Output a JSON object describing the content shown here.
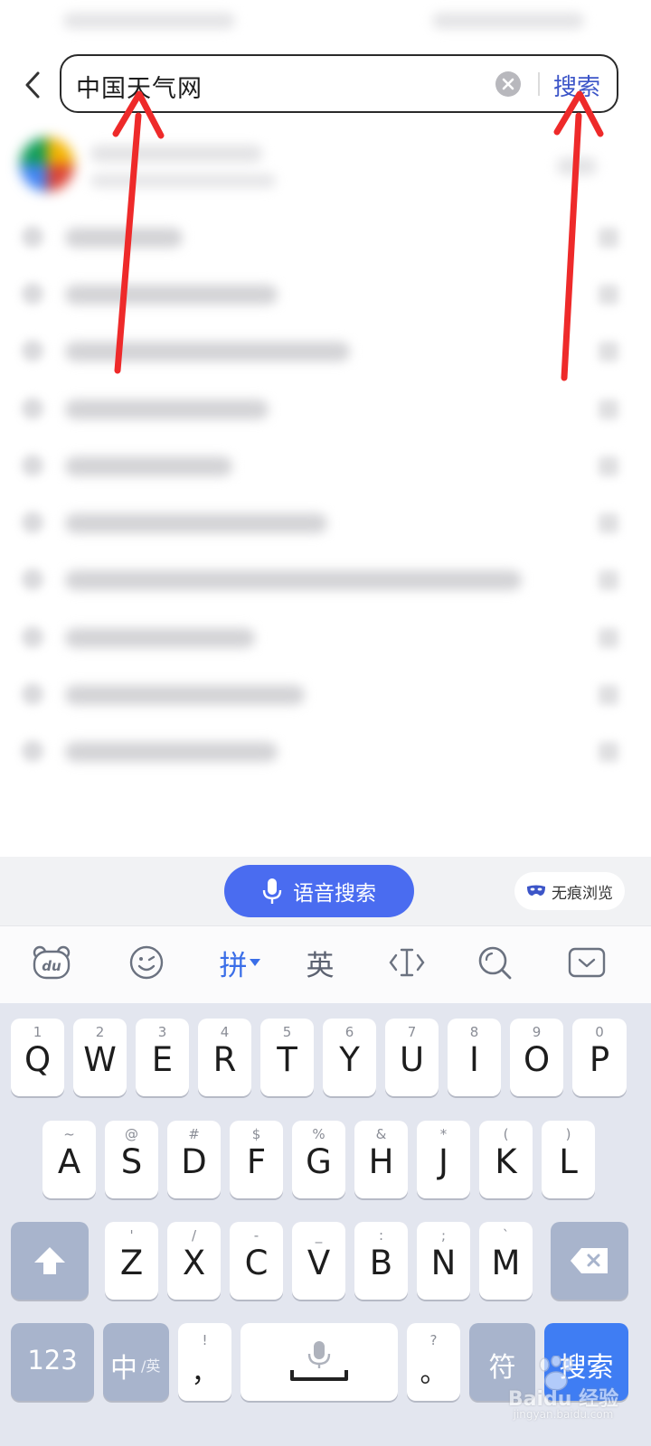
{
  "search": {
    "query": "中国天气网",
    "submit_label": "搜索"
  },
  "keyboard_bar": {
    "voice_label": "语音搜索",
    "incognito_label": "无痕浏览"
  },
  "toolbar": {
    "pinyin_label": "拼",
    "english_label": "英"
  },
  "keyboard": {
    "row1": [
      {
        "num": "1",
        "letter": "Q"
      },
      {
        "num": "2",
        "letter": "W"
      },
      {
        "num": "3",
        "letter": "E"
      },
      {
        "num": "4",
        "letter": "R"
      },
      {
        "num": "5",
        "letter": "T"
      },
      {
        "num": "6",
        "letter": "Y"
      },
      {
        "num": "7",
        "letter": "U"
      },
      {
        "num": "8",
        "letter": "I"
      },
      {
        "num": "9",
        "letter": "O"
      },
      {
        "num": "0",
        "letter": "P"
      }
    ],
    "row2": [
      {
        "num": "~",
        "letter": "A"
      },
      {
        "num": "@",
        "letter": "S"
      },
      {
        "num": "#",
        "letter": "D"
      },
      {
        "num": "$",
        "letter": "F"
      },
      {
        "num": "%",
        "letter": "G"
      },
      {
        "num": "&",
        "letter": "H"
      },
      {
        "num": "*",
        "letter": "J"
      },
      {
        "num": "(",
        "letter": "K"
      },
      {
        "num": ")",
        "letter": "L"
      }
    ],
    "row3": [
      {
        "num": "'",
        "letter": "Z"
      },
      {
        "num": "/",
        "letter": "X"
      },
      {
        "num": "-",
        "letter": "C"
      },
      {
        "num": "_",
        "letter": "V"
      },
      {
        "num": ":",
        "letter": "B"
      },
      {
        "num": ";",
        "letter": "N"
      },
      {
        "num": "`",
        "letter": "M"
      }
    ],
    "num_key": "123",
    "lang_key_main": "中",
    "lang_key_sub": "/英",
    "comma_top": "!",
    "comma_main": "，",
    "period_top": "?",
    "period_main": "。",
    "symbol_key": "符",
    "search_key": "搜索"
  },
  "watermark": {
    "brand": "Baidu 经验",
    "url": "jingyan.baidu.com"
  },
  "colors": {
    "accent": "#4a6cf0",
    "search_link": "#3c55c8",
    "annotation_arrow": "#ee2a2a"
  }
}
